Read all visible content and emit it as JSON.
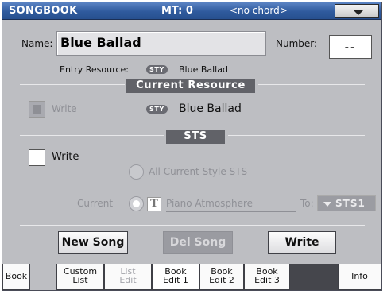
{
  "title_bar": {
    "title": "SONGBOOK",
    "mt": "MT: 0",
    "chord": "<no chord>",
    "menu_icon": "menu-arrow-icon"
  },
  "name": {
    "label": "Name:",
    "value": "Blue Ballad"
  },
  "number": {
    "label": "Number:",
    "value": "--"
  },
  "entry_resource": {
    "label": "Entry Resource:",
    "badge": "STY",
    "value": "Blue Ballad"
  },
  "current_resource": {
    "header": "Current Resource",
    "write_label": "Write",
    "badge": "STY",
    "value": "Blue Ballad"
  },
  "sts": {
    "header": "STS",
    "write_label": "Write",
    "all_current_label": "All Current Style STS",
    "current_label": "Current",
    "t_icon_label": "T",
    "current_value": "Piano Atmosphere",
    "to_label": "To:",
    "to_value": "STS1"
  },
  "buttons": {
    "new_song": "New Song",
    "del_song": "Del Song",
    "write": "Write"
  },
  "tabs": [
    {
      "line1": "Book",
      "line2": ""
    },
    {
      "line1": "Custom",
      "line2": "List"
    },
    {
      "line1": "List",
      "line2": "Edit"
    },
    {
      "line1": "Book",
      "line2": "Edit 1"
    },
    {
      "line1": "Book",
      "line2": "Edit 2"
    },
    {
      "line1": "Book",
      "line2": "Edit 3"
    },
    {
      "line1": "Info",
      "line2": ""
    }
  ],
  "colors": {
    "title_bar": "#2f5a9d",
    "panel": "#bdbec2",
    "section_header": "#616268",
    "disabled_text": "#8f9096"
  }
}
